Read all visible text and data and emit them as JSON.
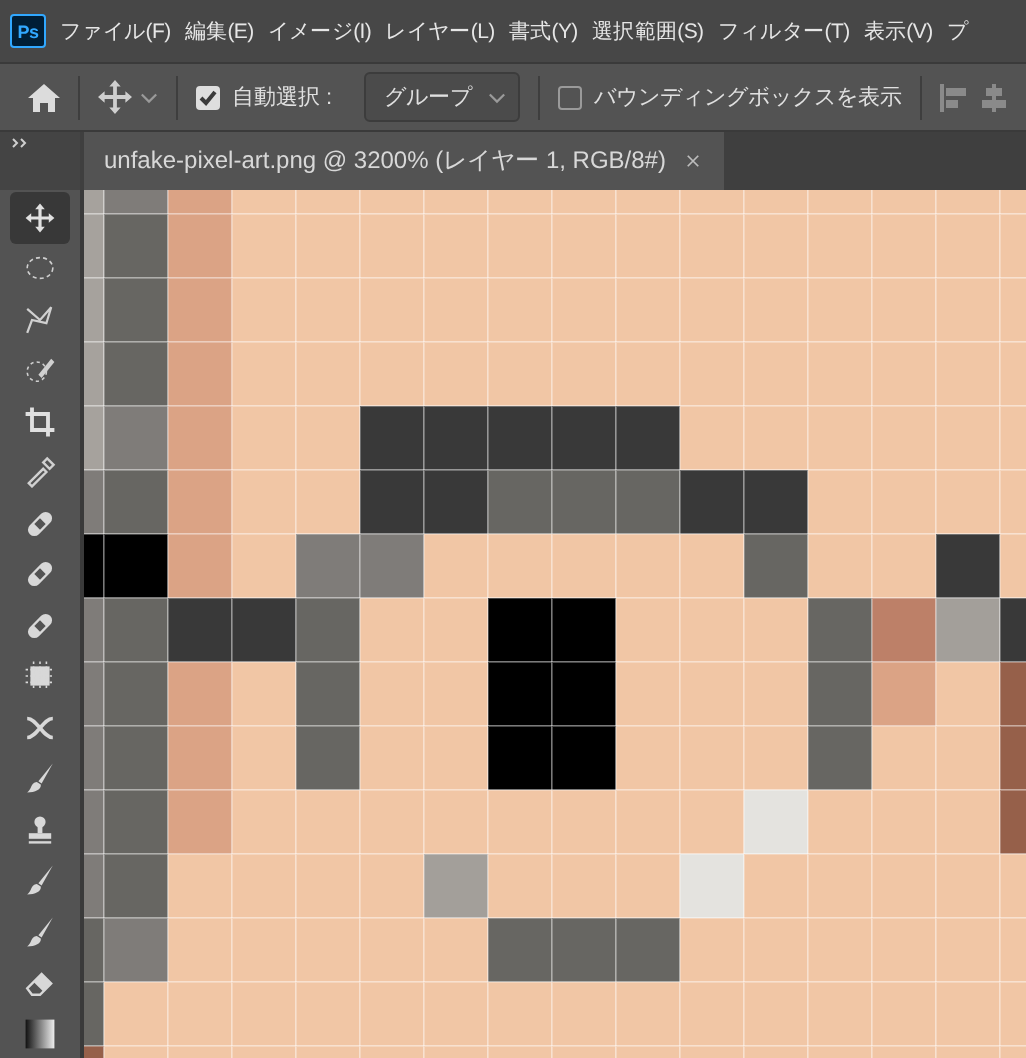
{
  "app": {
    "logo": "Ps"
  },
  "menu": [
    {
      "label": "ファイル(F)"
    },
    {
      "label": "編集(E)"
    },
    {
      "label": "イメージ(I)"
    },
    {
      "label": "レイヤー(L)"
    },
    {
      "label": "書式(Y)"
    },
    {
      "label": "選択範囲(S)"
    },
    {
      "label": "フィルター(T)"
    },
    {
      "label": "表示(V)"
    },
    {
      "label": "プ"
    }
  ],
  "options_bar": {
    "auto_select": {
      "label": "自動選択 :",
      "checked": true
    },
    "auto_select_target": "グループ",
    "show_bounding_box": {
      "label": "バウンディングボックスを表示",
      "checked": false
    }
  },
  "document_tabs": [
    {
      "title": "unfake-pixel-art.png @ 3200% (レイヤー 1, RGB/8#)",
      "selected": true
    }
  ],
  "tools": [
    {
      "kind": "move",
      "selected": true
    },
    {
      "kind": "marquee",
      "selected": false
    },
    {
      "kind": "lasso",
      "selected": false
    },
    {
      "kind": "quick-select",
      "selected": false
    },
    {
      "kind": "crop",
      "selected": false
    },
    {
      "kind": "eyedropper",
      "selected": false
    },
    {
      "kind": "spot-heal",
      "selected": false
    },
    {
      "kind": "heal",
      "selected": false
    },
    {
      "kind": "patch",
      "selected": false
    },
    {
      "kind": "chip",
      "selected": false
    },
    {
      "kind": "content-move",
      "selected": false
    },
    {
      "kind": "brush",
      "selected": false
    },
    {
      "kind": "stamp",
      "selected": false
    },
    {
      "kind": "history-brush",
      "selected": false
    },
    {
      "kind": "fill-brush",
      "selected": false
    },
    {
      "kind": "eraser",
      "selected": false
    },
    {
      "kind": "gradient",
      "selected": false
    }
  ]
}
